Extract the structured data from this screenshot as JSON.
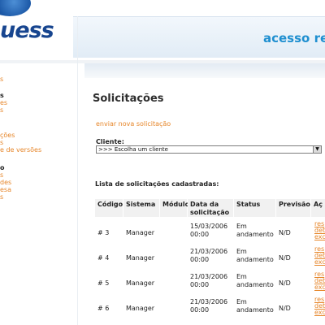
{
  "header": {
    "logo_text": "uess",
    "title": "acesso re"
  },
  "sidebar": {
    "items": [
      {
        "label": "s",
        "style": "link"
      },
      {
        "label": "s",
        "style": "heading"
      },
      {
        "label": "es",
        "style": "link"
      },
      {
        "label": "s",
        "style": "link"
      },
      {
        "label": "ções",
        "style": "link"
      },
      {
        "label": "s",
        "style": "link"
      },
      {
        "label": "e de versões",
        "style": "link"
      },
      {
        "label": "o",
        "style": "heading"
      },
      {
        "label": "s",
        "style": "link"
      },
      {
        "label": "des",
        "style": "link"
      },
      {
        "label": "esa",
        "style": "link"
      },
      {
        "label": "s",
        "style": "link"
      }
    ]
  },
  "main": {
    "title": "Solicitações",
    "new_request_link": "enviar nova solicitação",
    "client_label": "Cliente:",
    "client_select_value": ">>> Escolha um cliente",
    "list_title": "Lista de solicitações cadastradas:",
    "table": {
      "headers": [
        "Código",
        "Sistema",
        "Módulo",
        "Data da solicitação",
        "Status",
        "Previsão",
        "Aç"
      ],
      "rows": [
        {
          "codigo": "# 3",
          "sistema": "Manager",
          "modulo": "",
          "data": "15/03/2006",
          "hora": "00:00",
          "status1": "Em",
          "status2": "andamento",
          "previsao": "N/D"
        },
        {
          "codigo": "# 4",
          "sistema": "Manager",
          "modulo": "",
          "data": "21/03/2006",
          "hora": "00:00",
          "status1": "Em",
          "status2": "andamento",
          "previsao": "N/D"
        },
        {
          "codigo": "# 5",
          "sistema": "Manager",
          "modulo": "",
          "data": "21/03/2006",
          "hora": "00:00",
          "status1": "Em",
          "status2": "andamento",
          "previsao": "N/D"
        },
        {
          "codigo": "# 6",
          "sistema": "Manager",
          "modulo": "",
          "data": "21/03/2006",
          "hora": "00:00",
          "status1": "Em",
          "status2": "andamento",
          "previsao": "N/D"
        }
      ],
      "actions": [
        "res",
        "deta",
        "exc"
      ]
    }
  },
  "colors": {
    "accent_link": "#e6862a",
    "header_title": "#1f8fd0",
    "logo": "#17458f"
  }
}
